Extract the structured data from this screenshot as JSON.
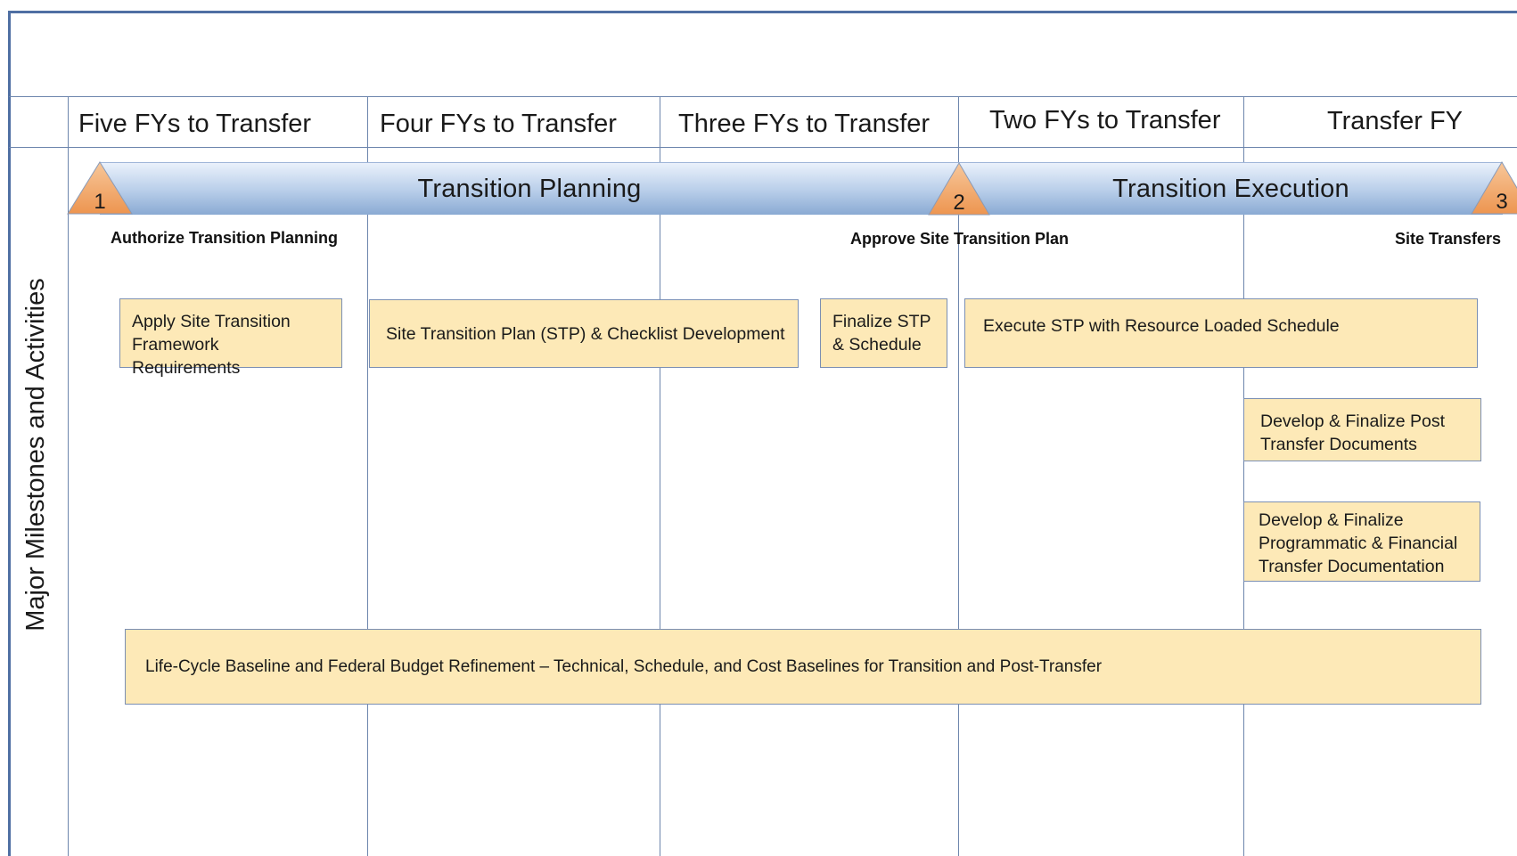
{
  "columns": [
    "Five FYs to Transfer",
    "Four FYs to Transfer",
    "Three FYs to Transfer",
    "Two FYs to Transfer",
    "Transfer FY"
  ],
  "row_label": "Major Milestones and Activities",
  "phases": {
    "planning": "Transition Planning",
    "execution": "Transition Execution"
  },
  "milestones": [
    {
      "number": "1",
      "label": "Authorize Transition Planning"
    },
    {
      "number": "2",
      "label": "Approve Site Transition Plan"
    },
    {
      "number": "3",
      "label": "Site Transfers"
    }
  ],
  "activities": [
    "Apply Site Transition Framework Requirements",
    "Site Transition Plan (STP) & Checklist Development",
    "Finalize STP & Schedule",
    "Execute STP with Resource Loaded Schedule",
    "Develop & Finalize Post Transfer Documents",
    "Develop & Finalize Programmatic & Financial Transfer Documentation",
    "Life-Cycle Baseline and Federal Budget Refinement – Technical, Schedule, and Cost Baselines for Transition and Post-Transfer"
  ],
  "colors": {
    "grid_line": "#6d86ad",
    "frame": "#4f6fa3",
    "activity_fill": "#fde9b7",
    "activity_border": "#7b8fb3",
    "milestone_fill": "#f0a55e",
    "phase_bar_top": "#eaf1fb",
    "phase_bar_bottom": "#8aaad3"
  },
  "icons": {
    "milestone": "triangle-milestone-icon"
  }
}
